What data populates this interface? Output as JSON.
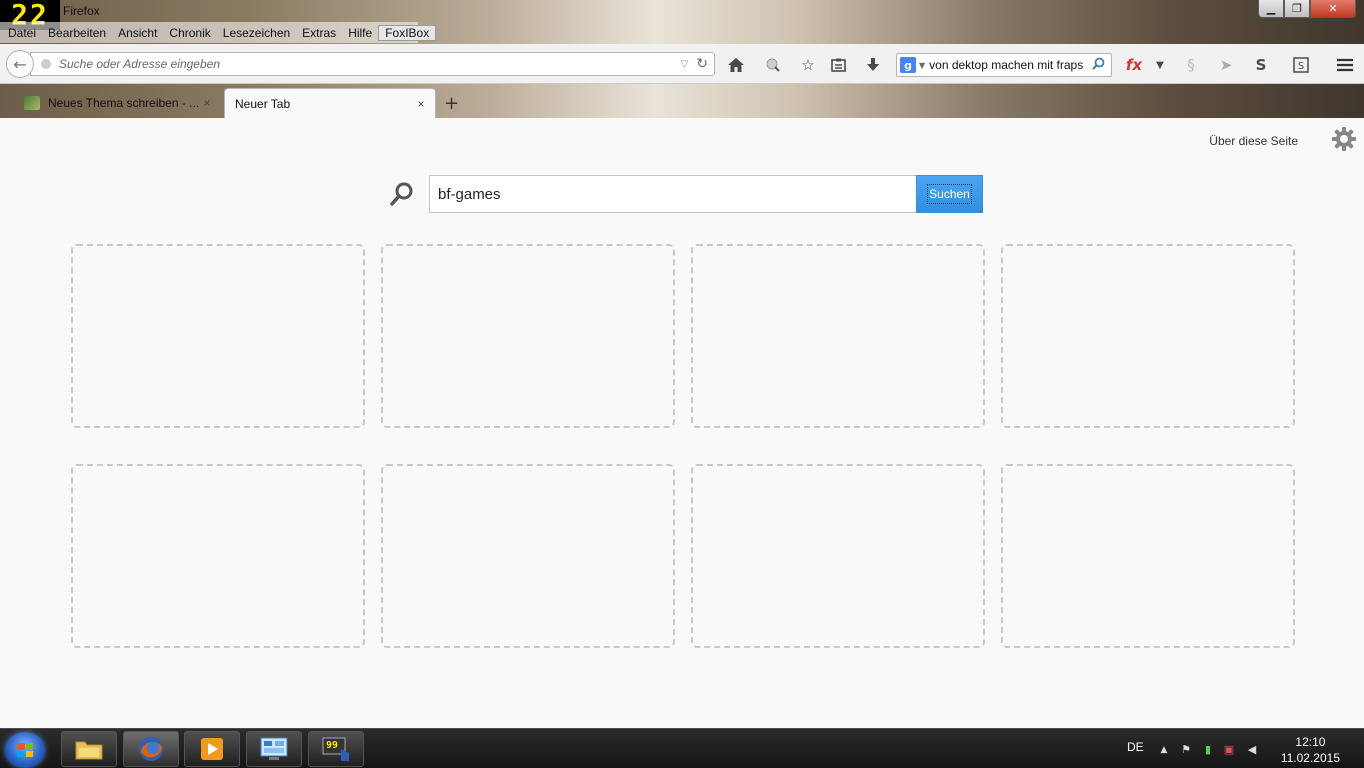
{
  "overlay": {
    "fps": "22"
  },
  "window": {
    "title": "Firefox",
    "minimize_label": "▁",
    "maximize_label": "❐",
    "close_label": "✕"
  },
  "menubar": {
    "items": [
      "Datei",
      "Bearbeiten",
      "Ansicht",
      "Chronik",
      "Lesezeichen",
      "Extras",
      "Hilfe",
      "FoxIBox"
    ]
  },
  "navbar": {
    "url_placeholder": "Suche oder Adresse eingeben",
    "search_engine": "g",
    "search_value": "von dektop machen mit fraps"
  },
  "tabs": [
    {
      "label": "Neues Thema schreiben - ...",
      "close": "×"
    },
    {
      "label": "Neuer Tab",
      "close": "×"
    }
  ],
  "new_tab_symbol": "+",
  "content": {
    "about_link": "Über diese Seite",
    "search_value": "bf-games",
    "search_button": "Suchen",
    "tile_count": 8
  },
  "taskbar": {
    "language": "DE",
    "time": "12:10",
    "date": "11.02.2015",
    "app_badge": "99"
  },
  "colors": {
    "accent_blue": "#2f8ee0",
    "tile_border": "#c9c9c9",
    "fps_yellow": "#ffea00"
  }
}
